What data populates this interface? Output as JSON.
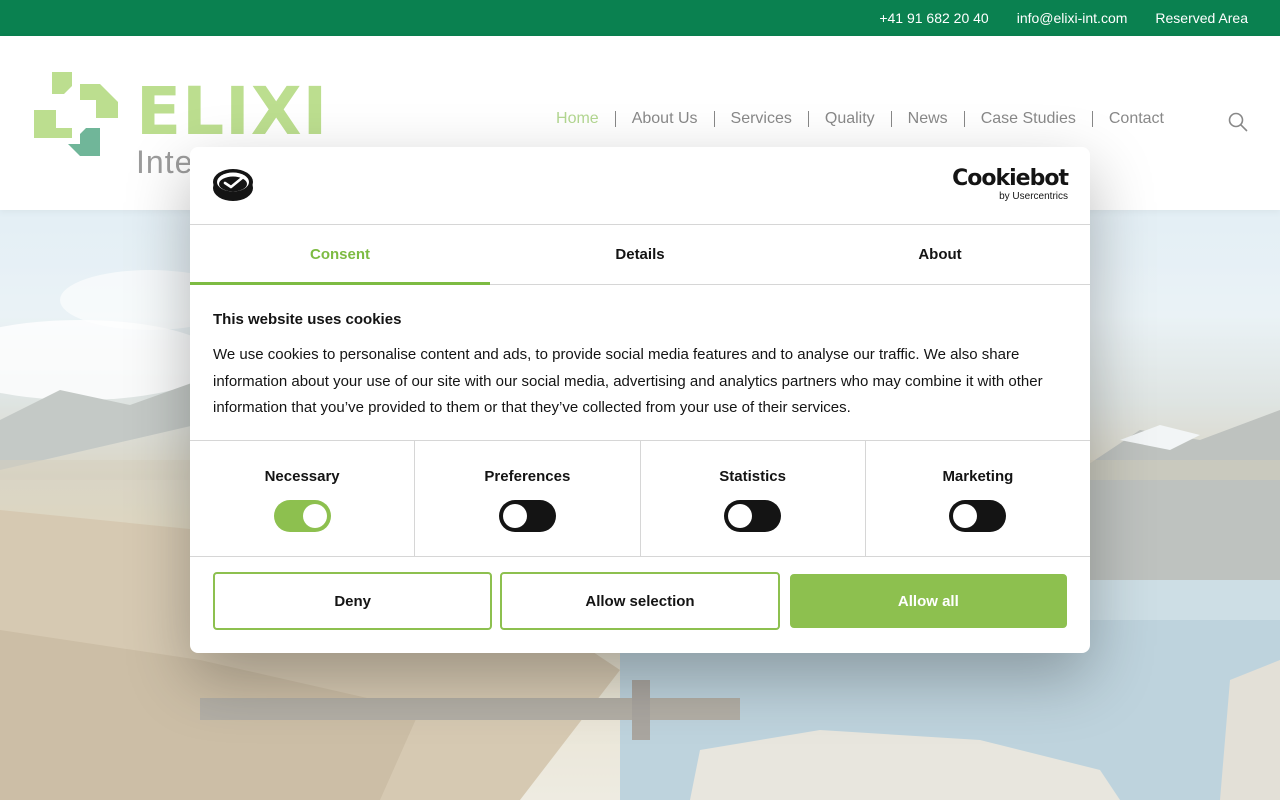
{
  "topbar": {
    "phone": "+41 91 682 20 40",
    "email": "info@elixi-int.com",
    "reserved": "Reserved Area"
  },
  "logo": {
    "word": "ELIXI",
    "subtitle": "Inte"
  },
  "nav": {
    "items": [
      "Home",
      "About Us",
      "Services",
      "Quality",
      "News",
      "Case Studies",
      "Contact"
    ],
    "active": "Home"
  },
  "cookie_dialog": {
    "brand": "Cookiebot",
    "brand_sub": "by Usercentrics",
    "tabs": [
      "Consent",
      "Details",
      "About"
    ],
    "active_tab": "Consent",
    "title": "This website uses cookies",
    "body": "We use cookies to personalise content and ads, to provide social media features and to analyse our traffic. We also share information about your use of our site with our social media, advertising and analytics partners who may combine it with other information that you’ve provided to them or that they’ve collected from your use of their services.",
    "categories": [
      {
        "label": "Necessary",
        "enabled": true
      },
      {
        "label": "Preferences",
        "enabled": false
      },
      {
        "label": "Statistics",
        "enabled": false
      },
      {
        "label": "Marketing",
        "enabled": false
      }
    ],
    "buttons": {
      "deny": "Deny",
      "allow_selection": "Allow selection",
      "allow_all": "Allow all"
    }
  },
  "colors": {
    "topbar": "#0a8150",
    "accent": "#8dc04f",
    "brand_green": "#8cc63f"
  },
  "icons": {
    "search": "search-icon",
    "cookiebot": "cookiebot-logo-icon"
  }
}
